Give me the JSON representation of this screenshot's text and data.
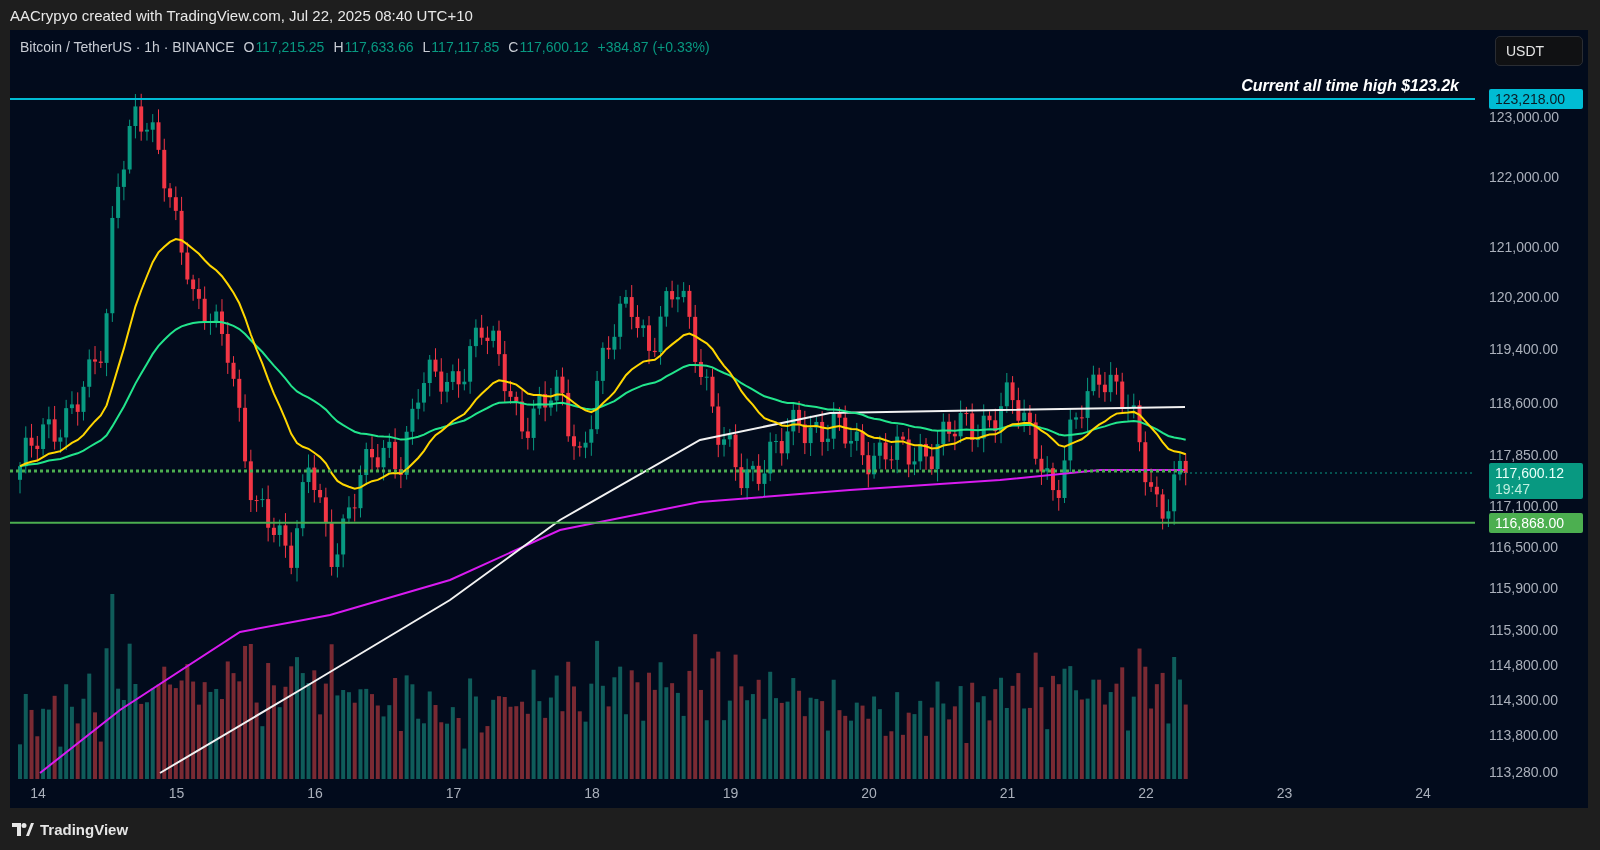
{
  "header": {
    "attribution": "AACrypyo created with TradingView.com, Jul 22, 2025 08:40 UTC+10"
  },
  "legend": {
    "symbol": "Bitcoin / TetherUS · 1h · BINANCE",
    "ohlc": [
      {
        "key": "O",
        "value": "117,215.25"
      },
      {
        "key": "H",
        "value": "117,633.66"
      },
      {
        "key": "L",
        "value": "117,117.85"
      },
      {
        "key": "C",
        "value": "117,600.12"
      }
    ],
    "change": "+384.87 (+0.33%)"
  },
  "currency_button": "USDT",
  "annotation": "Current all time high $123.2k",
  "price_axis": {
    "ticks": [
      "123,000.00",
      "122,000.00",
      "121,000.00",
      "120,200.00",
      "119,400.00",
      "118,600.00",
      "117,850.00",
      "117,100.00",
      "116,500.00",
      "115,900.00",
      "115,300.00",
      "114,800.00",
      "114,300.00",
      "113,800.00",
      "113,280.00"
    ],
    "labels": [
      {
        "kind": "ath",
        "text": "123,218.00"
      },
      {
        "kind": "last",
        "text": "117,600.12",
        "countdown": "19:47"
      },
      {
        "kind": "support",
        "text": "116,868.00"
      }
    ]
  },
  "time_axis": [
    "14",
    "15",
    "16",
    "17",
    "18",
    "19",
    "20",
    "21",
    "22",
    "23",
    "24"
  ],
  "footer": {
    "brand": "TradingView"
  }
}
